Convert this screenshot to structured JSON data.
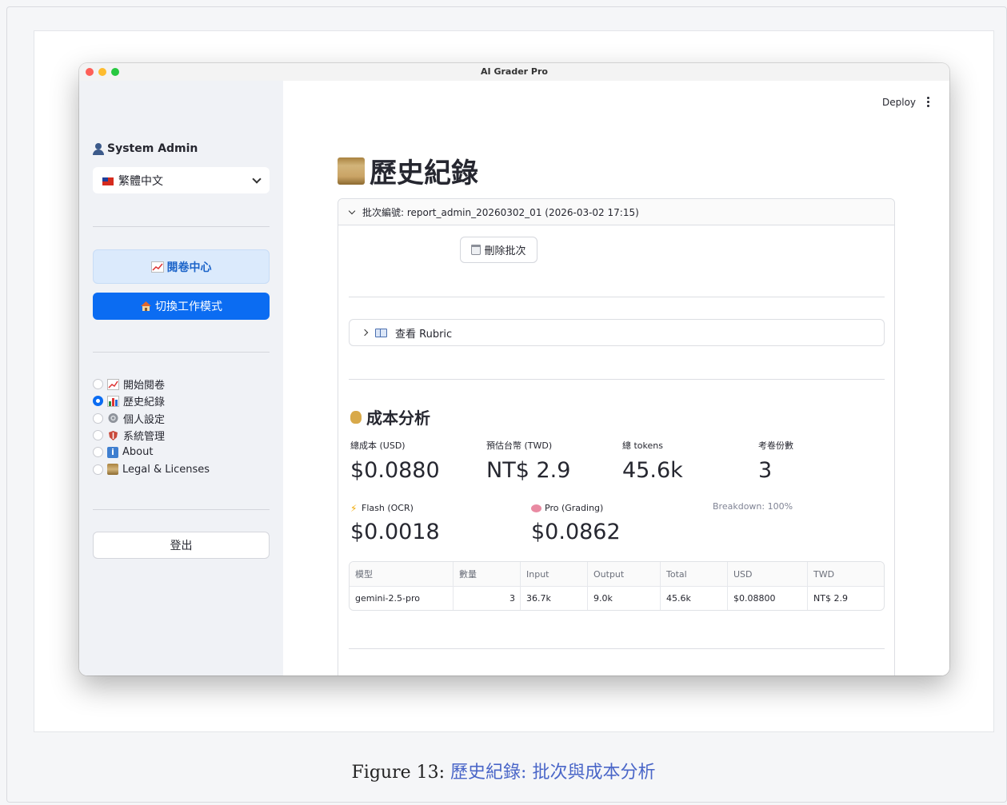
{
  "window": {
    "title": "AI Grader Pro"
  },
  "sidebar": {
    "user": "System Admin",
    "language": "繁體中文",
    "grading_center_button": "閱卷中心",
    "switch_mode_button": "切換工作模式",
    "nav": [
      {
        "label": "開始閱卷",
        "selected": false,
        "icon": "chart-up-icon"
      },
      {
        "label": "歷史紀錄",
        "selected": true,
        "icon": "bar-chart-icon"
      },
      {
        "label": "個人設定",
        "selected": false,
        "icon": "gear-icon"
      },
      {
        "label": "系統管理",
        "selected": false,
        "icon": "shield-icon"
      },
      {
        "label": "About",
        "selected": false,
        "icon": "info-icon"
      },
      {
        "label": "Legal & Licenses",
        "selected": false,
        "icon": "scroll-icon"
      }
    ],
    "logout_button": "登出"
  },
  "header": {
    "deploy": "Deploy"
  },
  "main": {
    "title": "歷史紀錄",
    "batch": {
      "label": "批次編號: report_admin_20260302_01 (2026-03-02 17:15)",
      "delete_button": "刪除批次",
      "rubric_label": "查看 Rubric"
    },
    "cost": {
      "title": "成本分析",
      "metrics": [
        {
          "label": "總成本 (USD)",
          "value": "$0.0880"
        },
        {
          "label": "預估台幣 (TWD)",
          "value": "NT$ 2.9"
        },
        {
          "label": "總 tokens",
          "value": "45.6k"
        },
        {
          "label": "考卷份數",
          "value": "3"
        }
      ],
      "flash": {
        "label": "Flash (OCR)",
        "value": "$0.0018"
      },
      "pro": {
        "label": "Pro (Grading)",
        "value": "$0.0862"
      },
      "breakdown": "Breakdown: 100%",
      "table": {
        "headers": [
          "模型",
          "數量",
          "Input",
          "Output",
          "Total",
          "USD",
          "TWD"
        ],
        "rows": [
          [
            "gemini-2.5-pro",
            "3",
            "36.7k",
            "9.0k",
            "45.6k",
            "$0.08800",
            "NT$ 2.9"
          ]
        ]
      }
    }
  },
  "figure": {
    "label": "Figure 13:",
    "caption": "歷史紀錄: 批次與成本分析"
  }
}
